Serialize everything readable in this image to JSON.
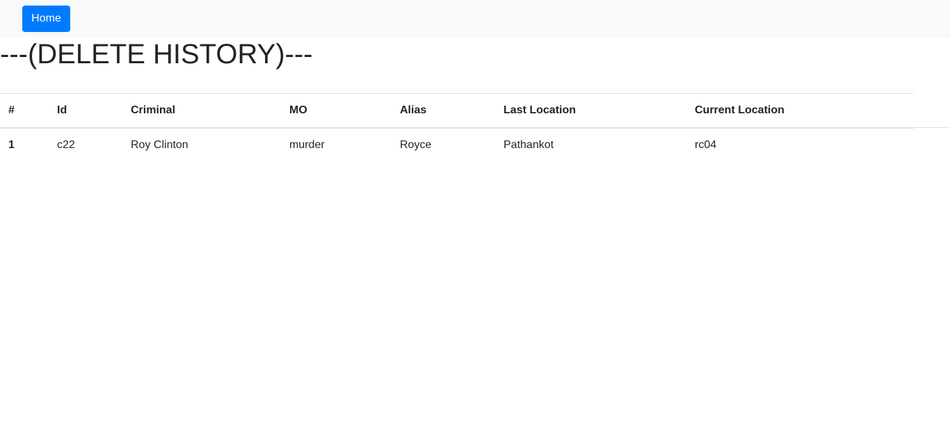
{
  "nav": {
    "home_label": "Home"
  },
  "page": {
    "title": "---(DELETE HISTORY)---"
  },
  "table": {
    "headers": [
      "#",
      "Id",
      "Criminal",
      "MO",
      "Alias",
      "Last Location",
      "Current Location"
    ],
    "rows": [
      [
        "1",
        "c22",
        "Roy Clinton",
        "murder",
        "Royce",
        "Pathankot",
        "rc04"
      ]
    ]
  },
  "colors": {
    "primary": "#007bff",
    "navbar_bg": "#f8f9fa",
    "text": "#212529",
    "border": "#dee2e6"
  }
}
